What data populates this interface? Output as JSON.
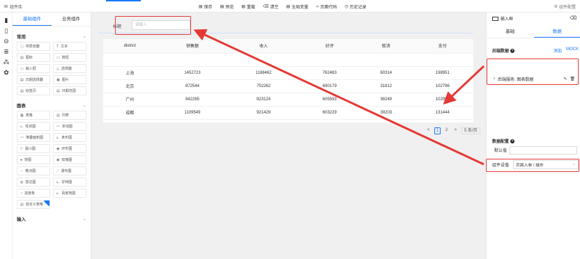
{
  "topbar": {
    "library_title": "组件库",
    "toolbar": [
      {
        "icon": "save-icon",
        "glyph": "▤",
        "label": "保存"
      },
      {
        "icon": "preview-icon",
        "glyph": "▤",
        "label": "预览"
      },
      {
        "icon": "reload-icon",
        "glyph": "▤",
        "label": "重载"
      },
      {
        "icon": "clear-icon",
        "glyph": "⌫",
        "label": "清空"
      },
      {
        "icon": "global-var-icon",
        "glyph": "▤",
        "label": "全局变量"
      },
      {
        "icon": "code-icon",
        "glyph": "‹›",
        "label": "页面代码"
      },
      {
        "icon": "history-icon",
        "glyph": "◷",
        "label": "历史记录"
      }
    ],
    "config_label": "组件配置"
  },
  "palette": {
    "tabs": [
      "基础组件",
      "业务组件"
    ],
    "sections": [
      {
        "title": "常用",
        "items": [
          {
            "glyph": "▢",
            "label": "布局容器"
          },
          {
            "glyph": "T",
            "label": "文本"
          },
          {
            "glyph": "▤",
            "label": "图标"
          },
          {
            "glyph": "▭",
            "label": "按钮"
          },
          {
            "glyph": "▭",
            "label": "输入框"
          },
          {
            "glyph": "△",
            "label": "选择器"
          },
          {
            "glyph": "▤",
            "label": "日期选择器"
          },
          {
            "glyph": "▣",
            "label": "图片"
          },
          {
            "glyph": "▤",
            "label": "标签页"
          },
          {
            "glyph": "▤",
            "label": "日期范围"
          }
        ]
      },
      {
        "title": "图表",
        "items": [
          {
            "glyph": "▦",
            "label": "表格"
          },
          {
            "glyph": "▤",
            "label": "列表"
          },
          {
            "glyph": "⊾",
            "label": "柱状图"
          },
          {
            "glyph": "〰",
            "label": "折线图"
          },
          {
            "glyph": "〰",
            "label": "堆叠面积图"
          },
          {
            "glyph": "⊾",
            "label": "条形图"
          },
          {
            "glyph": "▽",
            "label": "漏斗图"
          },
          {
            "glyph": "◉",
            "label": "环形图"
          },
          {
            "glyph": "●",
            "label": "饼图"
          },
          {
            "glyph": "◉",
            "label": "玫瑰图"
          },
          {
            "glyph": "⁘",
            "label": "散点图"
          },
          {
            "glyph": "⟋",
            "label": "瀑布图"
          },
          {
            "glyph": "◍",
            "label": "雷达图"
          },
          {
            "glyph": "⊾",
            "label": "甘特图"
          },
          {
            "glyph": "◔",
            "label": "进度条"
          },
          {
            "glyph": "⊾",
            "label": "百度地图"
          },
          {
            "glyph": "▤",
            "label": "自定义表格",
            "flag": true
          }
        ]
      },
      {
        "title": "输入",
        "items": []
      }
    ]
  },
  "form": {
    "label": "标题",
    "placeholder": "请输入"
  },
  "table": {
    "columns": [
      "district",
      "销售额",
      "收入",
      "好评",
      "取消",
      "支付"
    ],
    "rows": [
      [
        "",
        "",
        "",
        "",
        "",
        ""
      ],
      [
        "上海",
        "1452723",
        "1188462",
        "762483",
        "60314",
        "198951"
      ],
      [
        "北京",
        "872544",
        "752262",
        "690179",
        "31812",
        "102796"
      ],
      [
        "广州",
        "942265",
        "823124",
        "605593",
        "38249",
        "102952"
      ],
      [
        "成都",
        "1109549",
        "921429",
        "603229",
        "39203",
        "131444"
      ]
    ]
  },
  "pager": {
    "prev": "<",
    "pages": [
      "1",
      "2"
    ],
    "next": ">",
    "size": "5 条/页"
  },
  "right_panel": {
    "title": "输入框",
    "tabs": [
      "基础",
      "数据"
    ],
    "backend_label": "后端数据",
    "add_link": "添加",
    "mock_link": "MOCK",
    "service_item": "后端服务: 图表数据",
    "data_config_label": "数据配置",
    "default_label": "默认值",
    "setting_label": "组件设值",
    "setting_value": "页面入参 / 城市"
  },
  "colors": {
    "accent": "#1677ff",
    "highlight": "#e53935"
  }
}
